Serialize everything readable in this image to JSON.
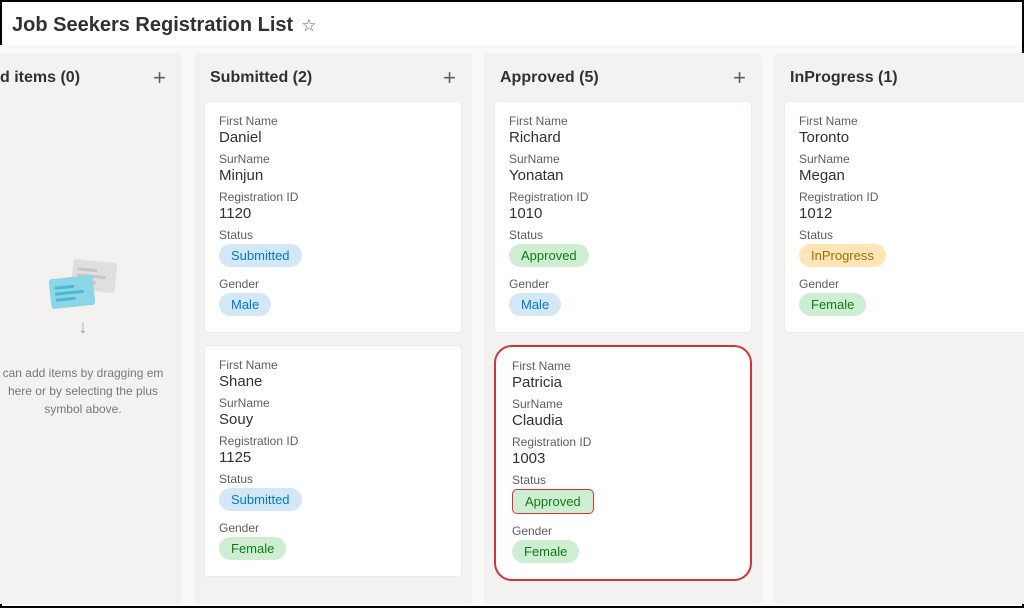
{
  "header": {
    "title": "Job Seekers Registration List"
  },
  "labels": {
    "firstName": "First Name",
    "surName": "SurName",
    "regId": "Registration ID",
    "status": "Status",
    "gender": "Gender"
  },
  "columns": [
    {
      "title": "d items (0)",
      "empty": true,
      "emptyText": "can add items by dragging em here or by selecting the plus symbol above."
    },
    {
      "title": "Submitted (2)",
      "cards": [
        {
          "firstName": "Daniel",
          "surName": "Minjun",
          "regId": "1120",
          "status": "Submitted",
          "statusClass": "submitted",
          "gender": "Male",
          "genderClass": "male"
        },
        {
          "firstName": "Shane",
          "surName": "Souy",
          "regId": "1125",
          "status": "Submitted",
          "statusClass": "submitted",
          "gender": "Female",
          "genderClass": "female"
        }
      ]
    },
    {
      "title": "Approved (5)",
      "cards": [
        {
          "firstName": "Richard",
          "surName": "Yonatan",
          "regId": "1010",
          "status": "Approved",
          "statusClass": "approved",
          "gender": "Male",
          "genderClass": "male"
        },
        {
          "firstName": "Patricia",
          "surName": "Claudia",
          "regId": "1003",
          "status": "Approved",
          "statusClass": "approved",
          "gender": "Female",
          "genderClass": "female",
          "highlight": true
        }
      ]
    },
    {
      "title": "InProgress (1)",
      "cards": [
        {
          "firstName": "Toronto",
          "surName": "Megan",
          "regId": "1012",
          "status": "InProgress",
          "statusClass": "inprogress",
          "gender": "Female",
          "genderClass": "female"
        }
      ]
    }
  ]
}
